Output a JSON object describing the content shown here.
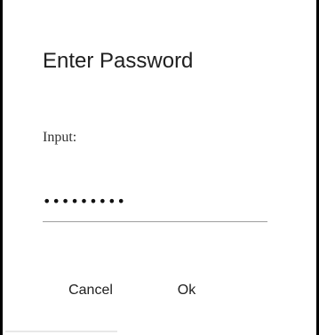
{
  "dialog": {
    "title": "Enter Password",
    "input_label": "Input:",
    "password_value": "•••••••••",
    "buttons": {
      "cancel": "Cancel",
      "ok": "Ok"
    }
  }
}
